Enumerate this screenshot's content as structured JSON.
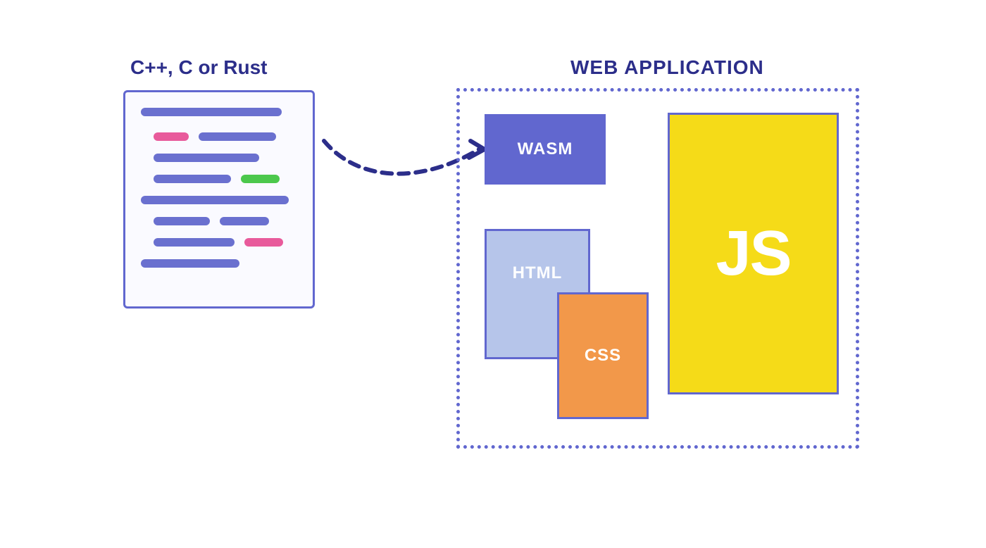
{
  "source": {
    "title": "C++, C or Rust"
  },
  "webapp": {
    "title": "WEB APPLICATION",
    "blocks": {
      "wasm": "WASM",
      "html": "HTML",
      "css": "CSS",
      "js": "JS"
    }
  },
  "colors": {
    "primary": "#6167cf",
    "darkText": "#2c2e8a",
    "pink": "#e85a9b",
    "green": "#4cc84c",
    "htmlBg": "#b6c5ea",
    "cssBg": "#f2984a",
    "jsBg": "#f5db18"
  }
}
